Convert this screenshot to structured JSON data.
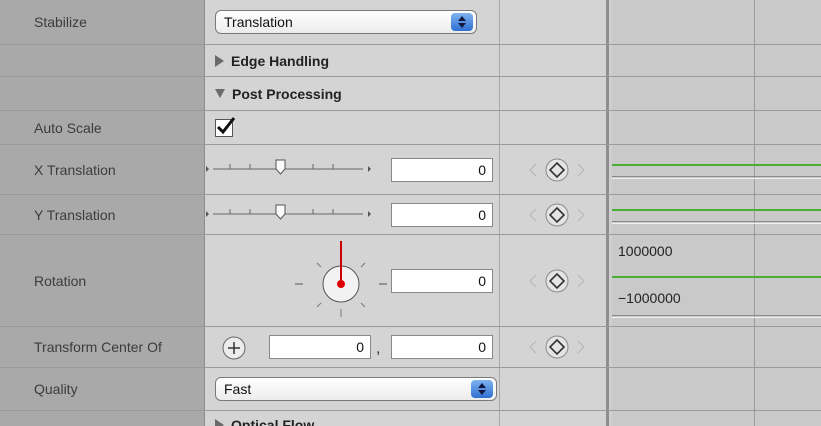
{
  "rows": {
    "stabilize": {
      "label": "Stabilize",
      "value": "Translation"
    },
    "edge_handling": {
      "label": "Edge Handling"
    },
    "post_processing": {
      "label": "Post Processing"
    },
    "auto_scale": {
      "label": "Auto Scale",
      "checked": true
    },
    "x_translation": {
      "label": "X Translation",
      "value": "0"
    },
    "y_translation": {
      "label": "Y Translation",
      "value": "0"
    },
    "rotation": {
      "label": "Rotation",
      "value": "0",
      "curve_max": "1000000",
      "curve_min": "−1000000"
    },
    "transform_center": {
      "label": "Transform Center Of",
      "x_value": "0",
      "separator": ",",
      "y_value": "0"
    },
    "quality": {
      "label": "Quality",
      "value": "Fast"
    },
    "optical_flow": {
      "label": "Optical Flow"
    }
  },
  "icons": {
    "popup_arrows": "up-down-arrows-icon",
    "disclosure_collapsed": "triangle-right-icon",
    "disclosure_expanded": "triangle-down-icon",
    "checkmark": "checkmark-icon",
    "keyframe": "diamond-icon",
    "prev_keyframe": "triangle-left-icon",
    "next_keyframe": "triangle-right-icon",
    "onscreen_control": "crosshair-plus-icon"
  },
  "colors": {
    "label_bg": "#a9a9a9",
    "control_bg": "#d4d4d4",
    "curve": "#4caf35",
    "popup_accent": "#2e6fd0"
  }
}
